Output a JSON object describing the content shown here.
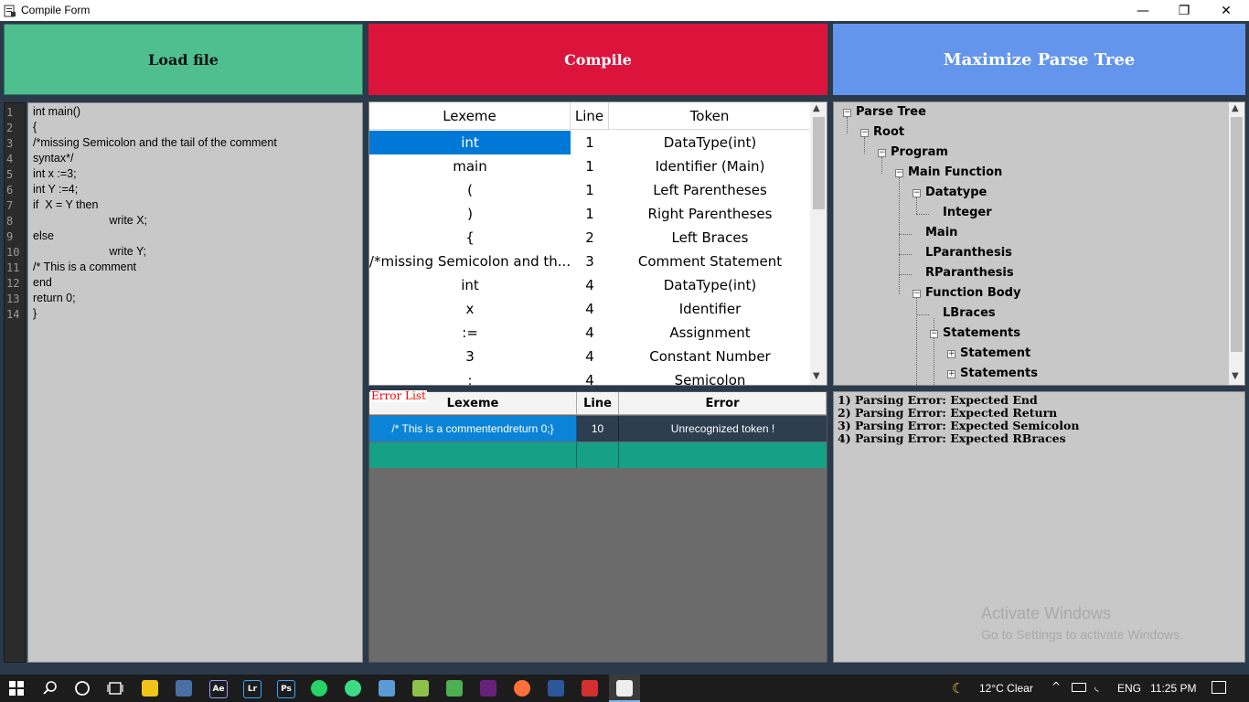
{
  "window": {
    "title": "Compile Form",
    "minimize_glyph": "—",
    "restore_glyph": "❐",
    "close_glyph": "✕"
  },
  "buttons": {
    "load": "Load file",
    "compile": "Compile",
    "maximize": "Maximize Parse Tree"
  },
  "editor": {
    "line_numbers": [
      "1",
      "2",
      "3",
      "4",
      "5",
      "6",
      "7",
      "8",
      "9",
      "10",
      "11",
      "12",
      "13",
      "14"
    ],
    "lines": [
      "int main()",
      "{",
      "/*missing Semicolon and the tail of the comment",
      "syntax*/",
      "int x :=3;",
      "int Y :=4;",
      "if  X = Y then",
      "                        write X;",
      "else",
      "                        write Y;",
      "/* This is a comment",
      "end",
      "return 0;",
      "}"
    ]
  },
  "lexeme_table": {
    "headers": [
      "Lexeme",
      "Line",
      "Token"
    ],
    "rows": [
      [
        "int",
        "1",
        "DataType(int)"
      ],
      [
        "main",
        "1",
        "Identifier (Main)"
      ],
      [
        "(",
        "1",
        "Left Parentheses"
      ],
      [
        ")",
        "1",
        "Right Parentheses"
      ],
      [
        "{",
        "2",
        "Left Braces"
      ],
      [
        "/*missing Semicolon and th...",
        "3",
        "Comment Statement"
      ],
      [
        "int",
        "4",
        "DataType(int)"
      ],
      [
        "x",
        "4",
        "Identifier"
      ],
      [
        ":=",
        "4",
        "Assignment"
      ],
      [
        "3",
        "4",
        "Constant Number"
      ],
      [
        ";",
        "4",
        "Semicolon"
      ]
    ],
    "selected_row": 0
  },
  "error_list": {
    "label": "Error List",
    "headers": [
      "Lexeme",
      "Line",
      "Error"
    ],
    "rows": [
      [
        "/* This is a commentendreturn 0;}",
        "10",
        "Unrecognized token !"
      ]
    ]
  },
  "parse_tree": {
    "nodes": [
      {
        "label": "Parse Tree",
        "expander": "−"
      },
      {
        "label": "Root",
        "expander": "−"
      },
      {
        "label": "Program",
        "expander": "−"
      },
      {
        "label": "Main Function",
        "expander": "−"
      },
      {
        "label": "Datatype",
        "expander": "−"
      },
      {
        "label": "Integer",
        "expander": ""
      },
      {
        "label": "Main",
        "expander": ""
      },
      {
        "label": "LParanthesis",
        "expander": ""
      },
      {
        "label": "RParanthesis",
        "expander": ""
      },
      {
        "label": "Function Body",
        "expander": "−"
      },
      {
        "label": "LBraces",
        "expander": ""
      },
      {
        "label": "Statements",
        "expander": "−"
      },
      {
        "label": "Statement",
        "expander": "+"
      },
      {
        "label": "Statements",
        "expander": "+"
      }
    ]
  },
  "parse_errors": [
    "1) Parsing Error: Expected End",
    "2) Parsing Error: Expected Return",
    "3) Parsing Error: Expected Semicolon",
    "4) Parsing Error: Expected RBraces"
  ],
  "watermark": {
    "line1": "Activate Windows",
    "line2": "Go to Settings to activate Windows."
  },
  "taskbar": {
    "weather": "12°C  Clear",
    "language": "ENG",
    "time": "11:25 PM",
    "apps": [
      {
        "name": "after-effects",
        "label": "Ae",
        "color": "#1f0f4a",
        "text_color": "#9999ff"
      },
      {
        "name": "lightroom",
        "label": "Lr",
        "color": "#0a2a3f",
        "text_color": "#31a8ff"
      },
      {
        "name": "photoshop",
        "label": "Ps",
        "color": "#001e36",
        "text_color": "#31a8ff"
      }
    ]
  }
}
